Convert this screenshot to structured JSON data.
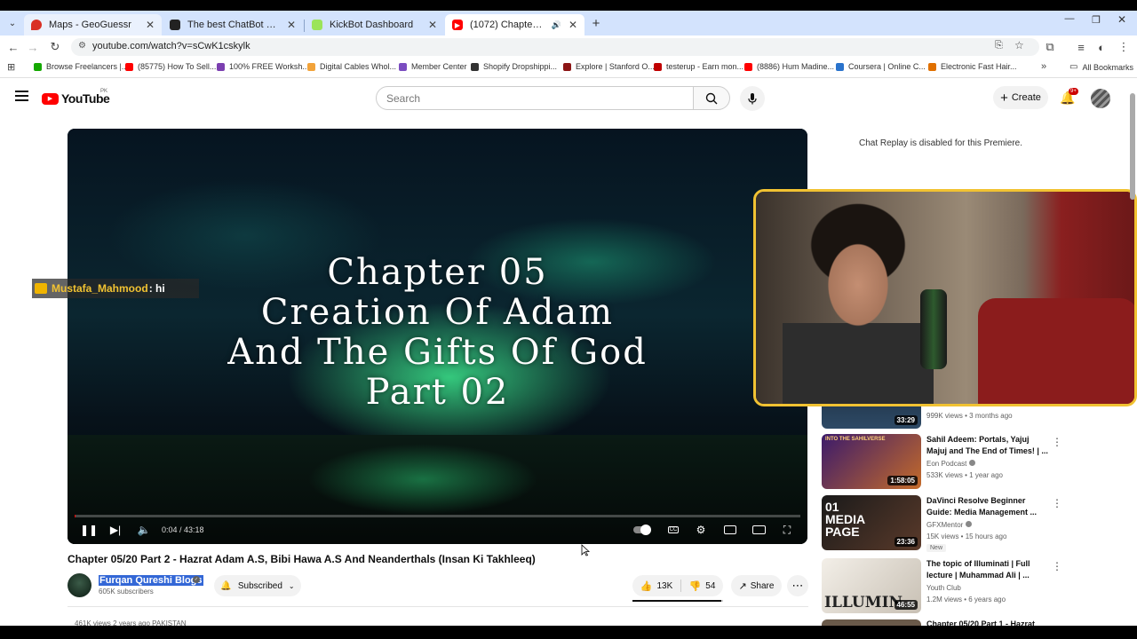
{
  "browser": {
    "tabs": [
      {
        "title": "Maps - GeoGuessr",
        "active": false,
        "favicon": "map-pin-icon"
      },
      {
        "title": "The best ChatBot and Widgets",
        "active": false,
        "favicon": "chatbot-icon"
      },
      {
        "title": "KickBot Dashboard",
        "active": false,
        "favicon": "kickbot-icon"
      },
      {
        "title": "(1072) Chapter 05/20 Part 2",
        "active": true,
        "favicon": "youtube-icon"
      }
    ],
    "url": "youtube.com/watch?v=sCwK1cskylk",
    "bookmarks": [
      {
        "label": "Browse Freelancers |...",
        "color": "#14a800"
      },
      {
        "label": "(85775) How To Sell...",
        "color": "#ff0000"
      },
      {
        "label": "100% FREE Worksh...",
        "color": "#7b3fb0"
      },
      {
        "label": "Digital Cables Whol...",
        "color": "#f2a33a"
      },
      {
        "label": "Member Center",
        "color": "#7a4cc0"
      },
      {
        "label": "Shopify Dropshippi...",
        "color": "#333333"
      },
      {
        "label": "Explore | Stanford O...",
        "color": "#8c1515"
      },
      {
        "label": "testerup - Earn mon...",
        "color": "#c00000"
      },
      {
        "label": "(8886) Hum Madine...",
        "color": "#ff0000"
      },
      {
        "label": "Coursera | Online C...",
        "color": "#2a73cc"
      },
      {
        "label": "Electronic Fast Hair...",
        "color": "#e07000"
      }
    ],
    "all_bookmarks": "All Bookmarks"
  },
  "youtube": {
    "logo": "YouTube",
    "region": "PK",
    "search_placeholder": "Search",
    "create_label": "Create",
    "notification_badge": "9+"
  },
  "video": {
    "overlay_lines": [
      "Chapter 05",
      "Creation Of Adam",
      "And The Gifts Of God",
      "Part 02"
    ],
    "chat_user": "Mustafa_Mahmood",
    "chat_message": ": hi",
    "time": "0:04 / 43:18",
    "progress": 0.0015,
    "title": "Chapter 05/20 Part 2 - Hazrat Adam A.S, Bibi Hawa A.S And Neanderthals (Insan Ki Takhleeq)",
    "channel": "Furqan Qureshi Blogs",
    "subscribers": "605K subscribers",
    "subscribed_label": "Subscribed",
    "likes": "13K",
    "dislikes": "54",
    "share_label": "Share",
    "views_line": "461K views  2 years ago  PAKISTAN"
  },
  "sidebar": {
    "chat_replay": "Chat Replay is disabled for this Premiere.",
    "partial_item": {
      "duration": "33:29",
      "meta": "999K views • 3 months ago"
    },
    "recommendations": [
      {
        "title": "Sahil Adeem: Portals, Yajuj Majuj and The End of Times! | ...",
        "channel": "Eon Podcast",
        "meta": "533K views • 1 year ago",
        "duration": "1:58:05",
        "thumb_text": "INTO THE SAHILVERSE",
        "new": ""
      },
      {
        "title": "DaVinci Resolve Beginner Guide: Media Management ...",
        "channel": "GFXMentor",
        "meta": "15K views • 15 hours ago",
        "duration": "23:36",
        "thumb_text": "01 MEDIA PAGE",
        "new": "New"
      },
      {
        "title": "The topic of Illuminati | Full lecture | Muhammad Ali | ...",
        "channel": "Youth Club",
        "meta": "1.2M views • 6 years ago",
        "duration": "46:55",
        "thumb_text": "ILLUMIN",
        "new": ""
      }
    ],
    "cutoff_title": "Chapter 05/20 Part 1 - Hazrat"
  }
}
